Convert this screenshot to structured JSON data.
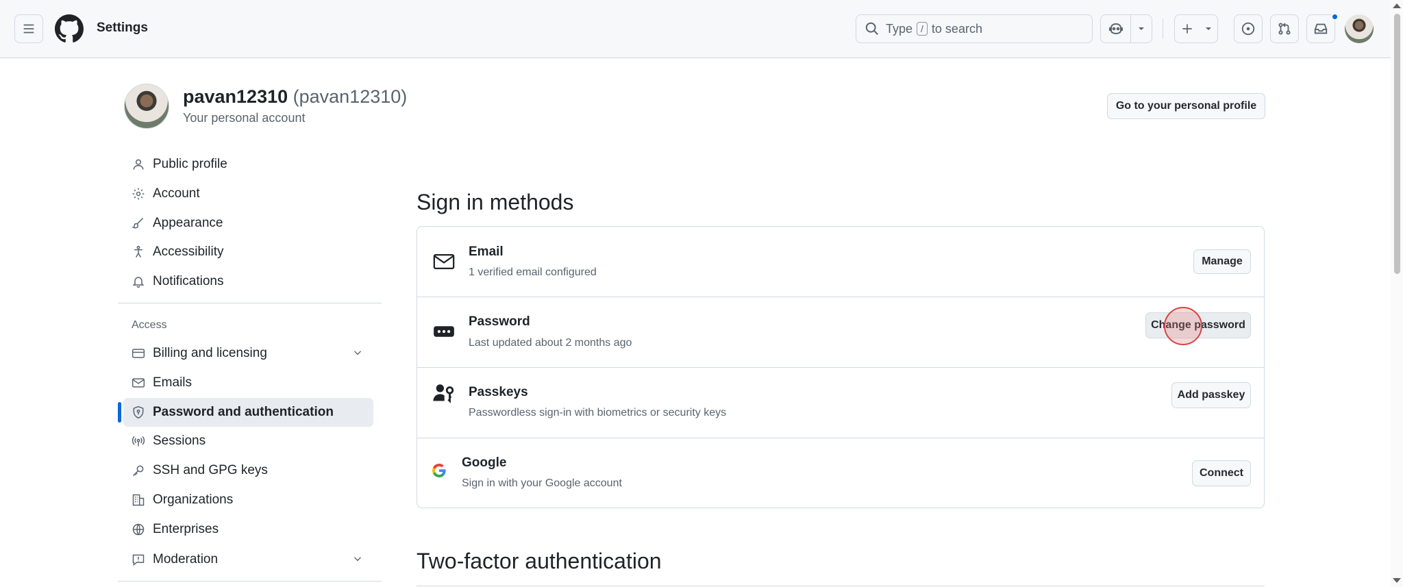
{
  "header": {
    "context": "Settings",
    "search": {
      "prefix": "Type",
      "key": "/",
      "suffix": "to search"
    }
  },
  "profile": {
    "display_name": "pavan12310",
    "login": "(pavan12310)",
    "subtitle": "Your personal account",
    "go_to_profile_label": "Go to your personal profile"
  },
  "sidebar": {
    "items": [
      {
        "label": "Public profile",
        "icon": "person-icon"
      },
      {
        "label": "Account",
        "icon": "gear-icon"
      },
      {
        "label": "Appearance",
        "icon": "paintbrush-icon"
      },
      {
        "label": "Accessibility",
        "icon": "accessibility-icon"
      },
      {
        "label": "Notifications",
        "icon": "bell-icon"
      }
    ],
    "access_heading": "Access",
    "access_items": [
      {
        "label": "Billing and licensing",
        "icon": "credit-card-icon"
      },
      {
        "label": "Emails",
        "icon": "mail-icon"
      },
      {
        "label": "Password and authentication",
        "icon": "shield-lock-icon",
        "active": true
      },
      {
        "label": "Sessions",
        "icon": "broadcast-icon"
      },
      {
        "label": "SSH and GPG keys",
        "icon": "key-icon"
      },
      {
        "label": "Organizations",
        "icon": "organization-icon"
      },
      {
        "label": "Enterprises",
        "icon": "globe-icon"
      },
      {
        "label": "Moderation",
        "icon": "report-icon"
      }
    ]
  },
  "main": {
    "sign_in_heading": "Sign in methods",
    "methods": [
      {
        "title": "Email",
        "description": "1 verified email configured",
        "action": "Manage",
        "icon": "mail-icon"
      },
      {
        "title": "Password",
        "description": "Last updated about 2 months ago",
        "action": "Change password",
        "icon": "password-icon"
      },
      {
        "title": "Passkeys",
        "description": "Passwordless sign-in with biometrics or security keys",
        "action": "Add passkey",
        "icon": "passkey-icon"
      },
      {
        "title": "Google",
        "description": "Sign in with your Google account",
        "action": "Connect",
        "icon": "google-icon"
      }
    ],
    "two_factor_heading": "Two-factor authentication"
  },
  "colors": {
    "accent": "#0969da",
    "border": "#d1d9e0",
    "muted": "#59636e",
    "text": "#1f2328"
  }
}
